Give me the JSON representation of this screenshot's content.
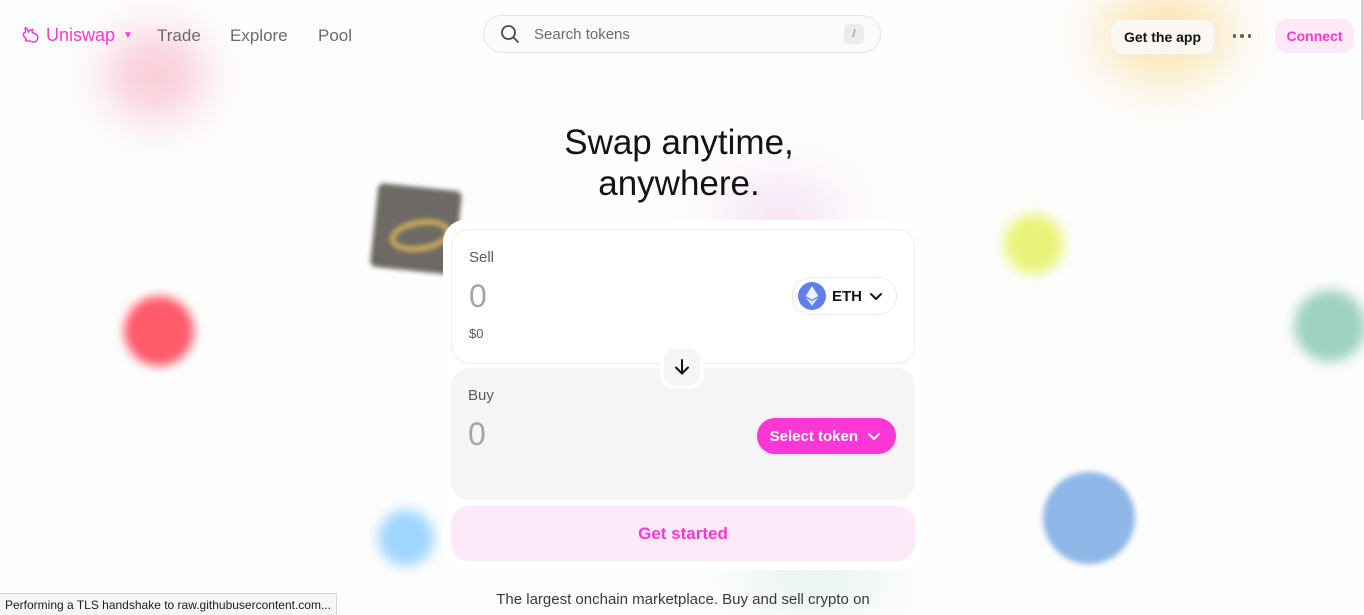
{
  "nav": {
    "logo": "Uniswap",
    "links": [
      "Trade",
      "Explore",
      "Pool"
    ],
    "search": {
      "placeholder": "Search tokens",
      "shortcut": "/"
    },
    "get_app": "Get the app",
    "connect": "Connect"
  },
  "hero": {
    "line1": "Swap anytime,",
    "line2": "anywhere."
  },
  "swap": {
    "sell": {
      "label": "Sell",
      "amount_placeholder": "0",
      "usd_value": "$0",
      "token": "ETH"
    },
    "buy": {
      "label": "Buy",
      "amount_placeholder": "0",
      "token_button": "Select token"
    },
    "cta": "Get started"
  },
  "tagline": "The largest onchain marketplace. Buy and sell crypto on",
  "browser_status": "Performing a TLS handshake to raw.githubusercontent.com...",
  "colors": {
    "brand_pink": "#fc37d6",
    "pink_soft": "#fde9f8",
    "eth_blue": "#627eea"
  }
}
